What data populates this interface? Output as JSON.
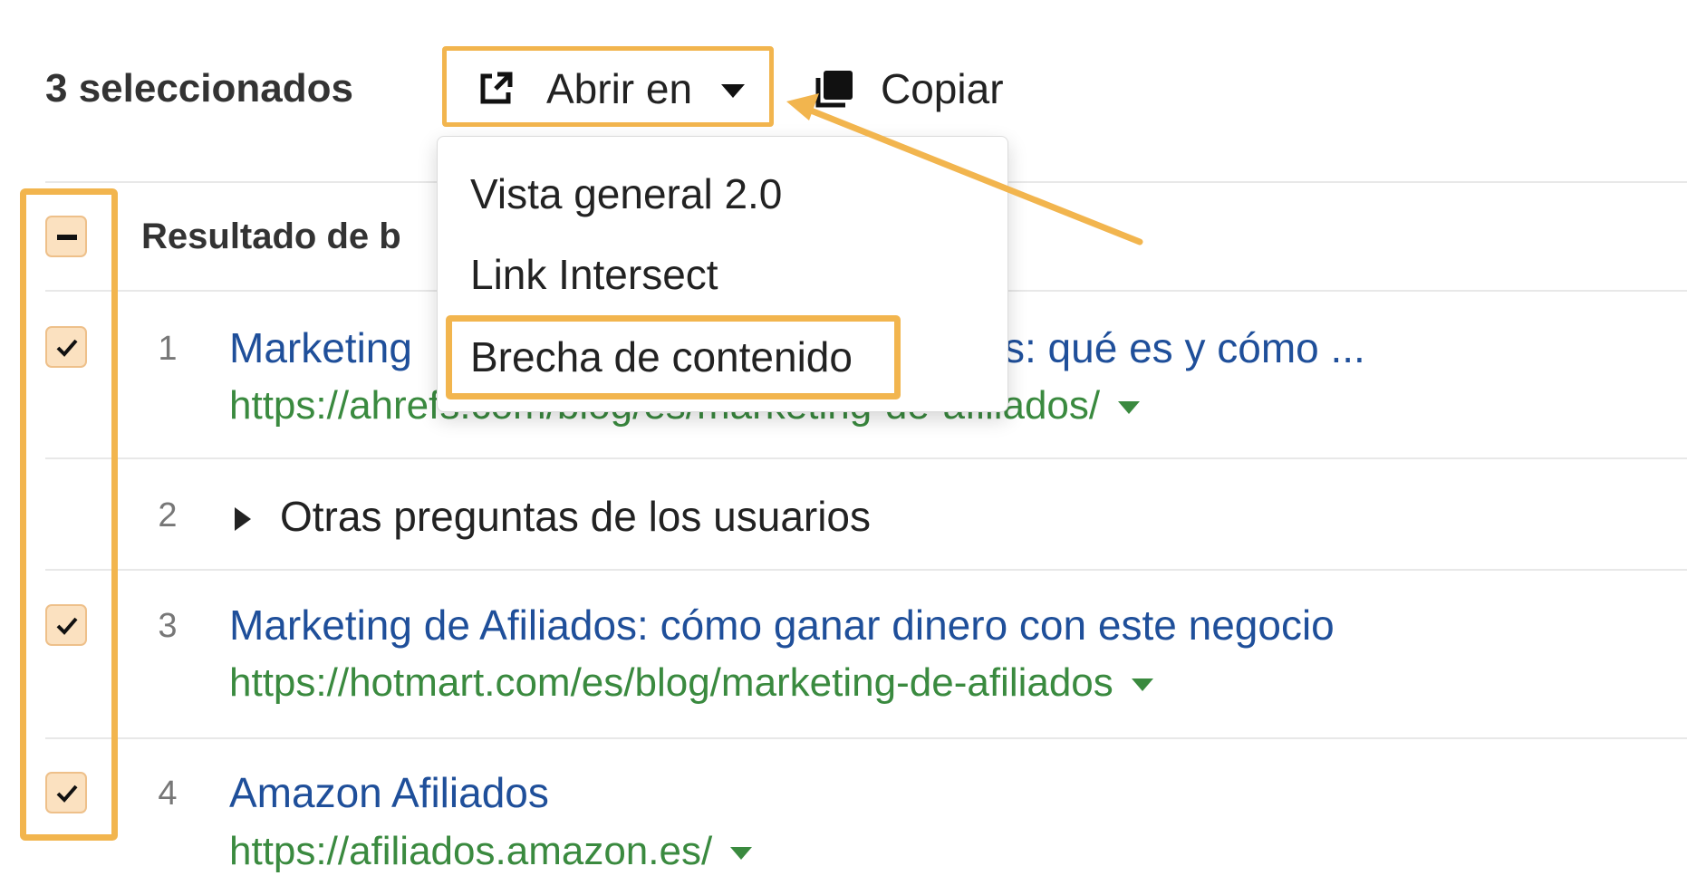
{
  "toolbar": {
    "selected_count": "3 seleccionados",
    "open_in_label": "Abrir en",
    "copy_label": "Copiar",
    "open_icon": "external-link-icon",
    "copy_icon": "copy-icon"
  },
  "open_menu": {
    "items": [
      "Vista general 2.0",
      "Link Intersect",
      "Brecha de contenido"
    ],
    "highlighted_item": "Brecha de contenido"
  },
  "table": {
    "header_label": "Resultado de b",
    "rows": [
      {
        "num": "1",
        "checked": true,
        "title_left": "Marketing",
        "title_right": "s: qué es y cómo ...",
        "url": "https://ahrefs.com/blog/es/marketing-de-afiliados/"
      },
      {
        "num": "2",
        "checked": false,
        "label": "Otras preguntas de los usuarios"
      },
      {
        "num": "3",
        "checked": true,
        "title": "Marketing de Afiliados: cómo ganar dinero con este negocio",
        "url": "https://hotmart.com/es/blog/marketing-de-afiliados"
      },
      {
        "num": "4",
        "checked": true,
        "title": "Amazon Afiliados",
        "url": "https://afiliados.amazon.es/"
      }
    ]
  },
  "colors": {
    "highlight": "#f2b54e",
    "link_title": "#1f4f9a",
    "link_url": "#3a8a3f",
    "checkbox_fill": "#fbe1c0"
  }
}
